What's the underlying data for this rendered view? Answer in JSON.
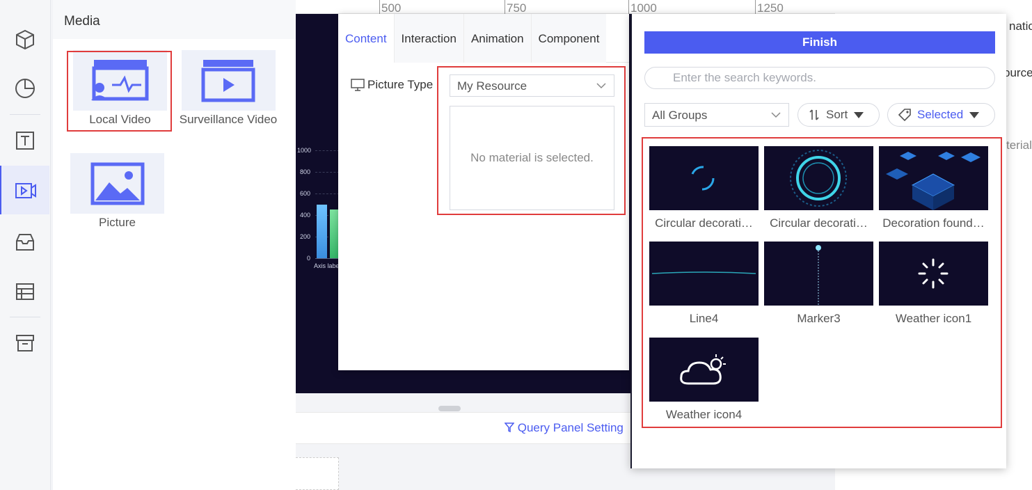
{
  "media_panel": {
    "title": "Media",
    "items": [
      {
        "label": "Local Video",
        "icon": "local-video-icon"
      },
      {
        "label": "Surveillance Video",
        "icon": "surveillance-video-icon"
      },
      {
        "label": "Picture",
        "icon": "picture-icon"
      }
    ]
  },
  "rail": [
    "cube-icon",
    "chart-pie-icon",
    "text-icon",
    "media-icon",
    "inbox-icon",
    "table-icon",
    "archive-icon"
  ],
  "ruler": {
    "ticks": [
      "500",
      "750",
      "1000",
      "1250"
    ]
  },
  "canvas": {
    "y_ticks": [
      "1000",
      "800",
      "600",
      "400",
      "200",
      "0"
    ],
    "x_axis_label": "Axis labe"
  },
  "bottom": {
    "query_panel": "Query Panel Setting"
  },
  "properties": {
    "tabs": [
      "Content",
      "Interaction",
      "Animation",
      "Component"
    ],
    "active_tab": "Content",
    "picture_type_label": "Picture Type",
    "source_select": "My Resource",
    "empty_text": "No material is selected."
  },
  "right_panel": {
    "frag_1": "natio",
    "frag_2": "ource",
    "frag_3": "terial"
  },
  "picker": {
    "finish": "Finish",
    "search_placeholder": "Enter the search keywords.",
    "groups": "All Groups",
    "sort": "Sort",
    "selected": "Selected",
    "items": [
      {
        "label": "Circular decorati…"
      },
      {
        "label": "Circular decorati…"
      },
      {
        "label": "Decoration found…"
      },
      {
        "label": "Line4"
      },
      {
        "label": "Marker3"
      },
      {
        "label": "Weather icon1"
      },
      {
        "label": "Weather icon4"
      }
    ]
  },
  "colors": {
    "accent": "#4b5cf0",
    "highlight": "#e03c3c",
    "thumb_bg": "#0f0c29"
  }
}
